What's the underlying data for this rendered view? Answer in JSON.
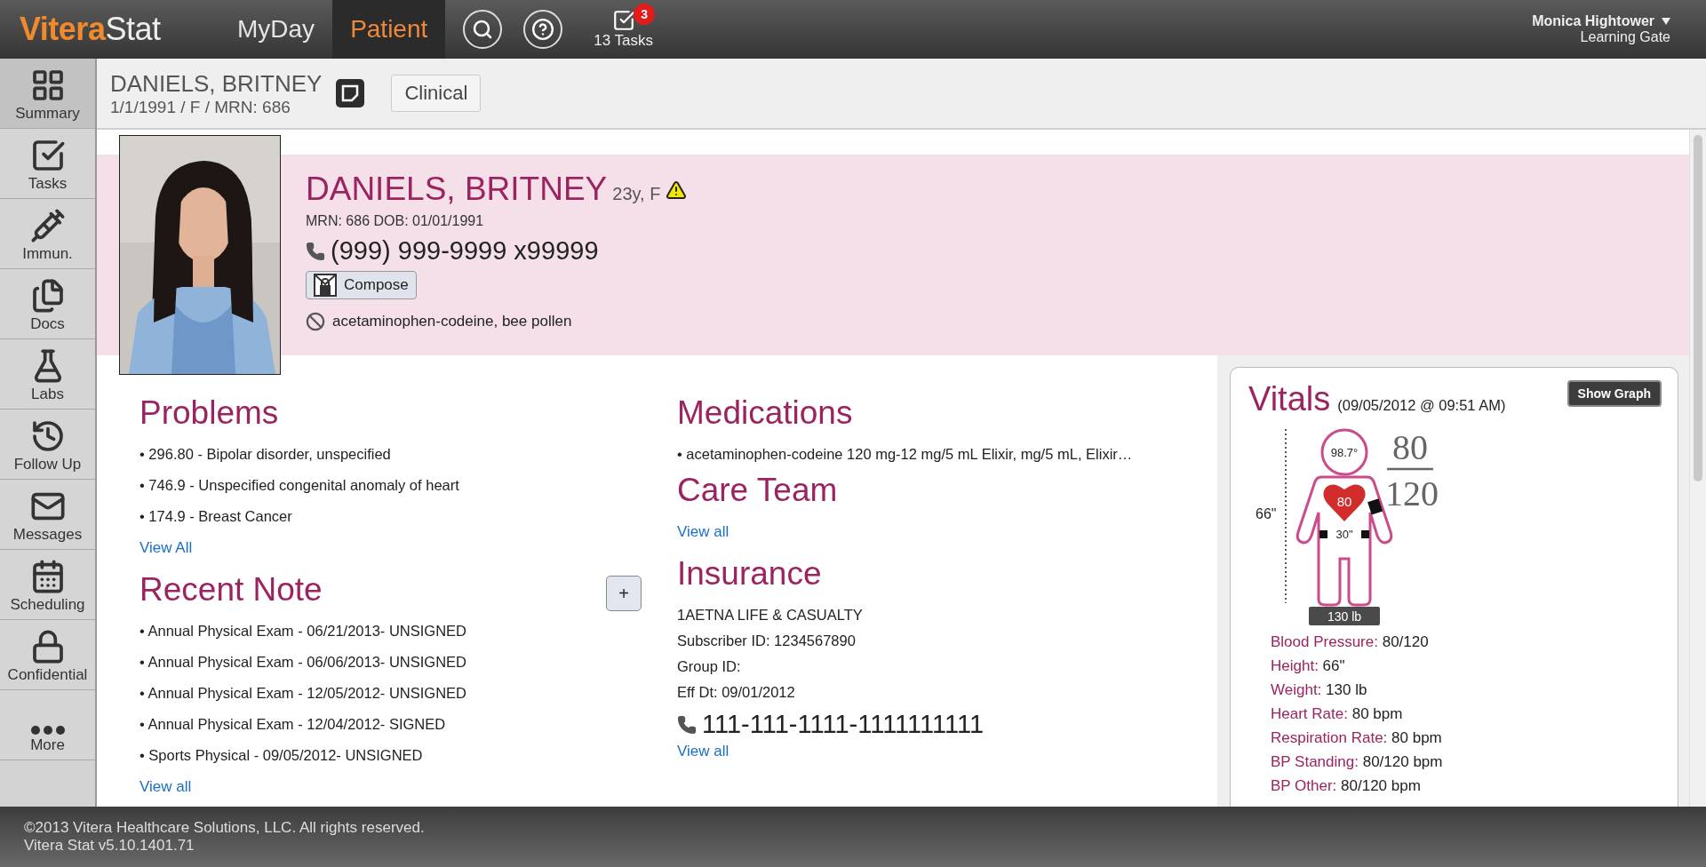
{
  "app": {
    "logo_first": "Vitera",
    "logo_second": "Stat"
  },
  "nav_tabs": [
    {
      "label": "MyDay",
      "selected": false
    },
    {
      "label": "Patient",
      "selected": true
    }
  ],
  "tasks": {
    "label": "13 Tasks",
    "badge": "3"
  },
  "user": {
    "name": "Monica Hightower",
    "location": "Learning Gate"
  },
  "sidebar": [
    {
      "label": "Summary",
      "kind": "summary",
      "selected": true
    },
    {
      "label": "Tasks",
      "kind": "tasks",
      "selected": false
    },
    {
      "label": "Immun.",
      "kind": "immun",
      "selected": false
    },
    {
      "label": "Docs",
      "kind": "docs",
      "selected": false
    },
    {
      "label": "Labs",
      "kind": "labs",
      "selected": false
    },
    {
      "label": "Follow Up",
      "kind": "followup",
      "selected": false
    },
    {
      "label": "Messages",
      "kind": "messages",
      "selected": false
    },
    {
      "label": "Scheduling",
      "kind": "scheduling",
      "selected": false
    },
    {
      "label": "Confidential",
      "kind": "confidential",
      "selected": false
    },
    {
      "label": "More",
      "kind": "more",
      "selected": false
    }
  ],
  "header": {
    "name": "DANIELS, BRITNEY",
    "details": "1/1/1991 / F / MRN: 686",
    "button": "Clinical"
  },
  "patient": {
    "name": "DANIELS, BRITNEY",
    "age_sex": "23y, F",
    "ids": "MRN: 686 DOB: 01/01/1991",
    "phone": "(999) 999-9999 x99999",
    "compose": "Compose",
    "allergies": "acetaminophen-codeine, bee pollen"
  },
  "problems": {
    "title": "Problems",
    "items": [
      "• 296.80 - Bipolar disorder, unspecified",
      "• 746.9 - Unspecified congenital anomaly of heart",
      "• 174.9 - Breast Cancer"
    ],
    "link": "View All"
  },
  "recent_note": {
    "title": "Recent Note",
    "add": "+",
    "items": [
      "•  Annual Physical Exam - 06/21/2013- UNSIGNED",
      "•  Annual Physical Exam - 06/06/2013- UNSIGNED",
      "•  Annual Physical Exam - 12/05/2012- UNSIGNED",
      "•  Annual Physical Exam - 12/04/2012- SIGNED",
      "•  Sports Physical - 09/05/2012- UNSIGNED"
    ],
    "link": "View all"
  },
  "medications": {
    "title": "Medications",
    "items": [
      "• acetaminophen-codeine 120 mg-12 mg/5 mL Elixir, mg/5 mL, Elixir…"
    ]
  },
  "care_team": {
    "title": "Care Team",
    "link": "View all"
  },
  "insurance": {
    "title": "Insurance",
    "lines": [
      "1AETNA LIFE & CASUALTY",
      "Subscriber ID: 1234567890",
      "Group ID:",
      "Eff Dt: 09/01/2012"
    ],
    "phone": "111-111-1111-1111111111",
    "link": "View all"
  },
  "vitals": {
    "title": "Vitals",
    "date": "(09/05/2012 @ 09:51 AM)",
    "button": "Show Graph",
    "figure": {
      "temperature": "98.7°",
      "systolic": "80",
      "diastolic": "120",
      "height": "66\"",
      "heart_rate": "80",
      "waist": "30\"",
      "weight": "130 lb"
    },
    "readings": [
      {
        "label": "Blood Pressure:",
        "value": "80/120"
      },
      {
        "label": "Height:",
        "value": "66\""
      },
      {
        "label": "Weight:",
        "value": "130 lb"
      },
      {
        "label": "Heart Rate:",
        "value": "80 bpm"
      },
      {
        "label": "Respiration Rate:",
        "value": "80 bpm"
      },
      {
        "label": "BP Standing:",
        "value": "80/120 bpm"
      },
      {
        "label": "BP Other:",
        "value": "80/120 bpm"
      }
    ]
  },
  "footer": {
    "copyright": "©2013 Vitera Healthcare Solutions, LLC. All rights reserved.",
    "version": "Vitera Stat v5.10.1401.71"
  }
}
